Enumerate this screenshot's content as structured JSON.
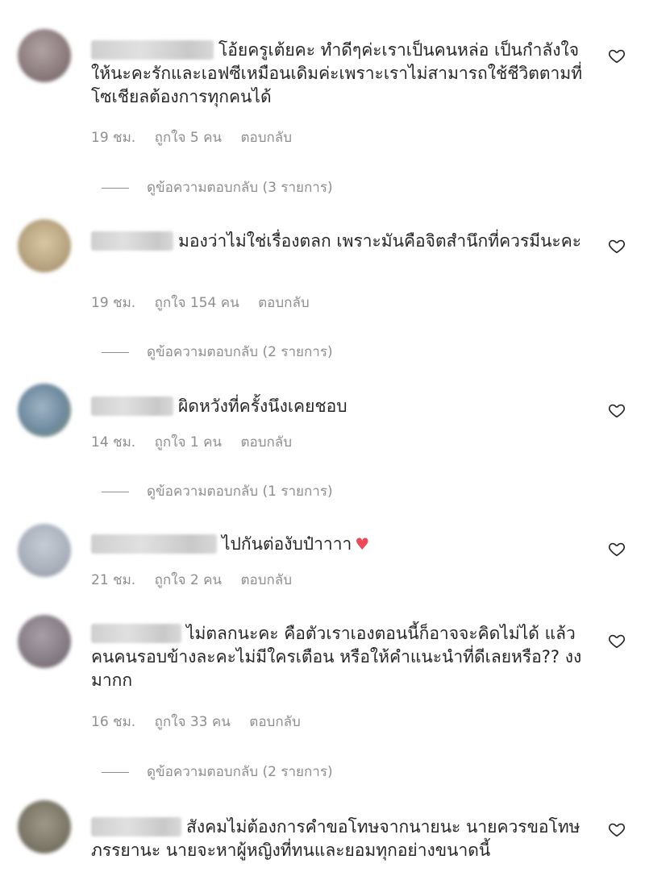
{
  "comments": [
    {
      "text": "โอ้ยครูเต้ยคะ ทำดีๆค่ะเราเป็นคนหล่อ เป็นกำลังใจให้นะคะรักและเอฟซีเหมือนเดิมค่ะเพราะเราไม่สามารถใช้ชีวิตตามที่โซเชียลต้องการทุกคนได้",
      "time": "19 ชม.",
      "likes": "ถูกใจ 5 คน",
      "reply": "ตอบกลับ",
      "view_replies": "ดูข้อความตอบกลับ (3 รายการ)",
      "avatar_color": "#8a7a7c"
    },
    {
      "text": "มองว่าไม่ใช่เรื่องตลก เพราะมันคือจิตสำนึกที่ควรมีนะคะ",
      "time": "19 ชม.",
      "likes": "ถูกใจ 154 คน",
      "reply": "ตอบกลับ",
      "view_replies": "ดูข้อความตอบกลับ (2 รายการ)",
      "avatar_color": "#b7a37f"
    },
    {
      "text": "ผิดหวังที่ครั้งนึงเคยชอบ",
      "time": "14 ชม.",
      "likes": "ถูกใจ 1 คน",
      "reply": "ตอบกลับ",
      "view_replies": "ดูข้อความตอบกลับ (1 รายการ)",
      "avatar_color": "#6f8aa0"
    },
    {
      "text": "ไปกันต่องับป๋าาาา",
      "emoji": "♥",
      "time": "21 ชม.",
      "likes": "ถูกใจ 2 คน",
      "reply": "ตอบกลับ",
      "view_replies": "",
      "avatar_color": "#a9b0bb"
    },
    {
      "text": "ไม่ตลกนะคะ คือตัวเราเองตอนนี้ก็อาจจะคิดไม่ได้ แล้วคนคนรอบข้างละคะไม่มีใครเตือน หรือให้คำแนะนำที่ดีเลยหรือ?? งงมากก",
      "time": "16 ชม.",
      "likes": "ถูกใจ 33 คน",
      "reply": "ตอบกลับ",
      "view_replies": "ดูข้อความตอบกลับ (2 รายการ)",
      "avatar_color": "#857b84"
    },
    {
      "text": "สังคมไม่ต้องการคำขอโทษจากนายนะ นายควรขอโทษภรรยานะ นายจะหาผู้หญิงที่ทนและยอมทุกอย่างขนาดนี้",
      "time": "",
      "likes": "",
      "reply": "",
      "view_replies": "",
      "avatar_color": "#7c7768"
    }
  ],
  "icons": {
    "like": "heart-outline-icon",
    "inline_emoji": "red-heart-emoji"
  }
}
